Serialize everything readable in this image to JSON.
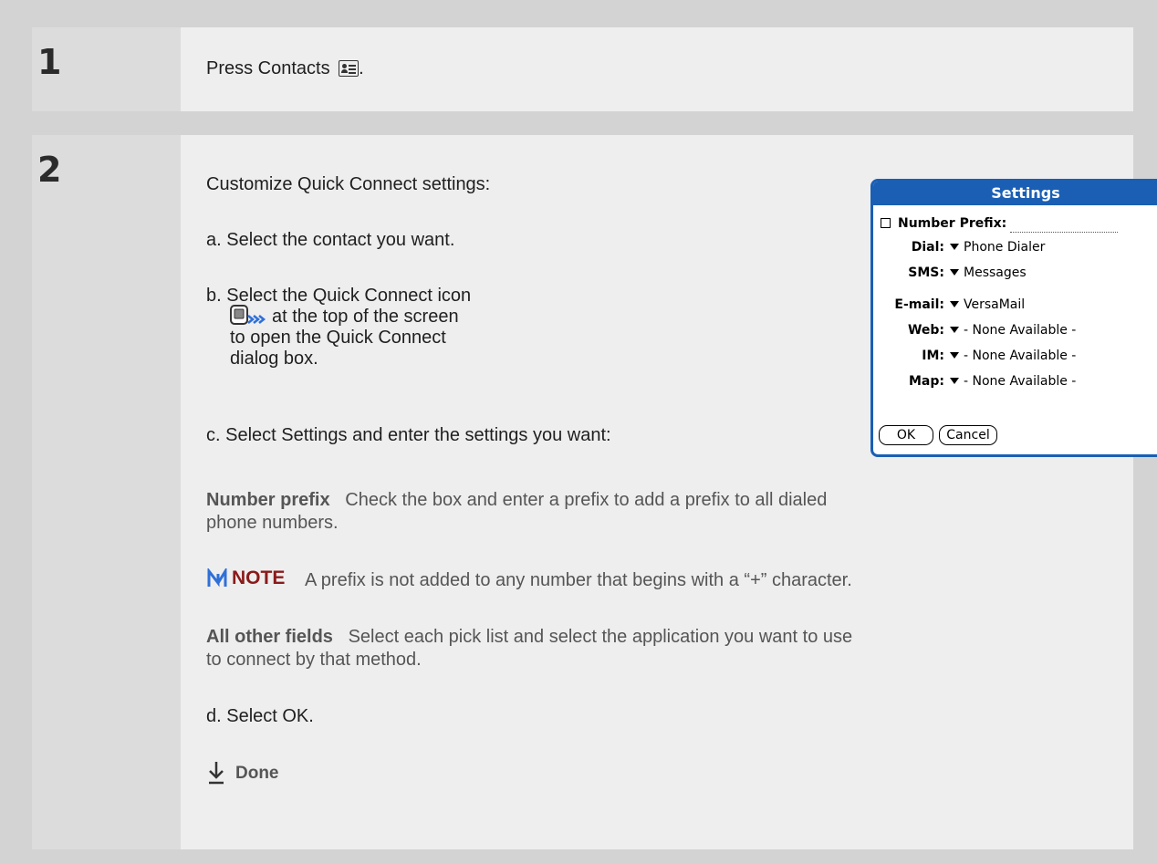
{
  "steps": [
    {
      "number": "1",
      "text": "Press Contacts",
      "text_suffix": "."
    },
    {
      "number": "2"
    }
  ],
  "step2": {
    "intro": "Customize Quick Connect settings:",
    "a": "a.  Select the contact you want.",
    "b_line1": "b.  Select the Quick Connect icon",
    "b_line2": "at the top of the screen",
    "b_line3": "to open the Quick Connect",
    "b_line4": "dialog box.",
    "c": "c.  Select Settings and enter the settings you want:",
    "number_prefix_term": "Number prefix",
    "number_prefix_desc_1": "Check the box and enter a prefix to add a prefix to all dialed",
    "number_prefix_desc_2": "phone numbers.",
    "note_label": "NOTE",
    "note_text": "A prefix is not added to any number that begins with a “+” character.",
    "all_other_term": "All other fields",
    "all_other_desc_1": "Select each pick list and select the application you want to use",
    "all_other_desc_2": "to connect by that method.",
    "d": "d.  Select OK.",
    "done": "Done"
  },
  "dialog": {
    "title": "Settings",
    "number_prefix_label": "Number Prefix:",
    "rows": [
      {
        "label": "Dial:",
        "value": "Phone Dialer"
      },
      {
        "label": "SMS:",
        "value": "Messages"
      },
      {
        "label": "E-mail:",
        "value": "VersaMail"
      },
      {
        "label": "Web:",
        "value": "- None Available -"
      },
      {
        "label": "IM:",
        "value": "- None Available -"
      },
      {
        "label": "Map:",
        "value": "- None Available -"
      }
    ],
    "ok": "OK",
    "cancel": "Cancel"
  },
  "colors": {
    "dialog_accent": "#1a5fb4",
    "note_red": "#8b1a1a",
    "qc_blue": "#2f6fd8"
  },
  "icons": [
    "contacts-icon",
    "quick-connect-icon",
    "info-icon",
    "note-icon",
    "done-arrow-icon"
  ]
}
